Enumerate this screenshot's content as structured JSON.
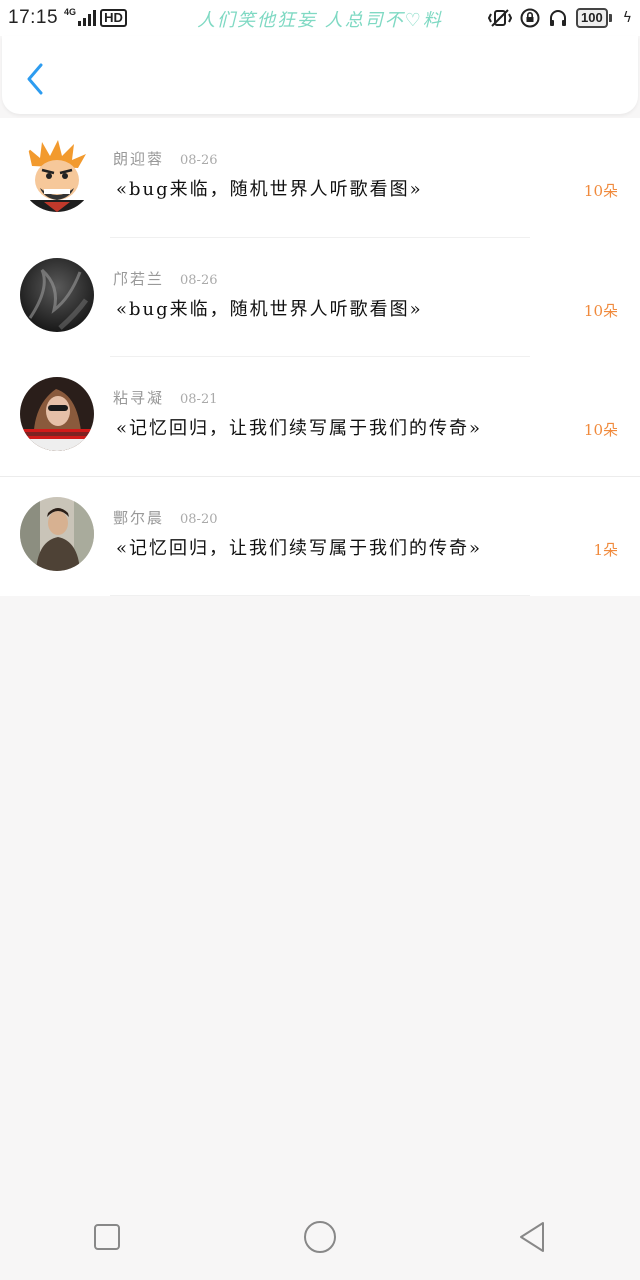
{
  "status_bar": {
    "time": "17:15",
    "network_label": "4G",
    "hd_label": "HD",
    "banner_text": "人们笑他狂妄 人总司不♡料",
    "battery_level": "100",
    "icons": [
      "signal-icon",
      "vibrate-icon",
      "lock-rotation-icon",
      "headphones-icon",
      "battery-icon",
      "charging-icon"
    ]
  },
  "header": {
    "back_icon": "chevron-left-icon",
    "accent_color": "#2d9cf0"
  },
  "list": {
    "items": [
      {
        "name": "朗迎蓉",
        "date": "08-26",
        "title": "«bug来临，随机世界人听歌看图»",
        "count": "10朵"
      },
      {
        "name": "邝若兰",
        "date": "08-26",
        "title": "«bug来临，随机世界人听歌看图»",
        "count": "10朵"
      },
      {
        "name": "粘寻凝",
        "date": "08-21",
        "title": "«记忆回归，让我们续写属于我们的传奇»",
        "count": "10朵"
      },
      {
        "name": "酆尔晨",
        "date": "08-20",
        "title": "«记忆回归，让我们续写属于我们的传奇»",
        "count": "1朵"
      }
    ]
  },
  "colors": {
    "count_color": "#f08a3c",
    "banner_color": "#7fd9c3"
  },
  "nav_bar": {
    "icons": [
      "recent-apps-icon",
      "home-icon",
      "back-triangle-icon"
    ]
  }
}
